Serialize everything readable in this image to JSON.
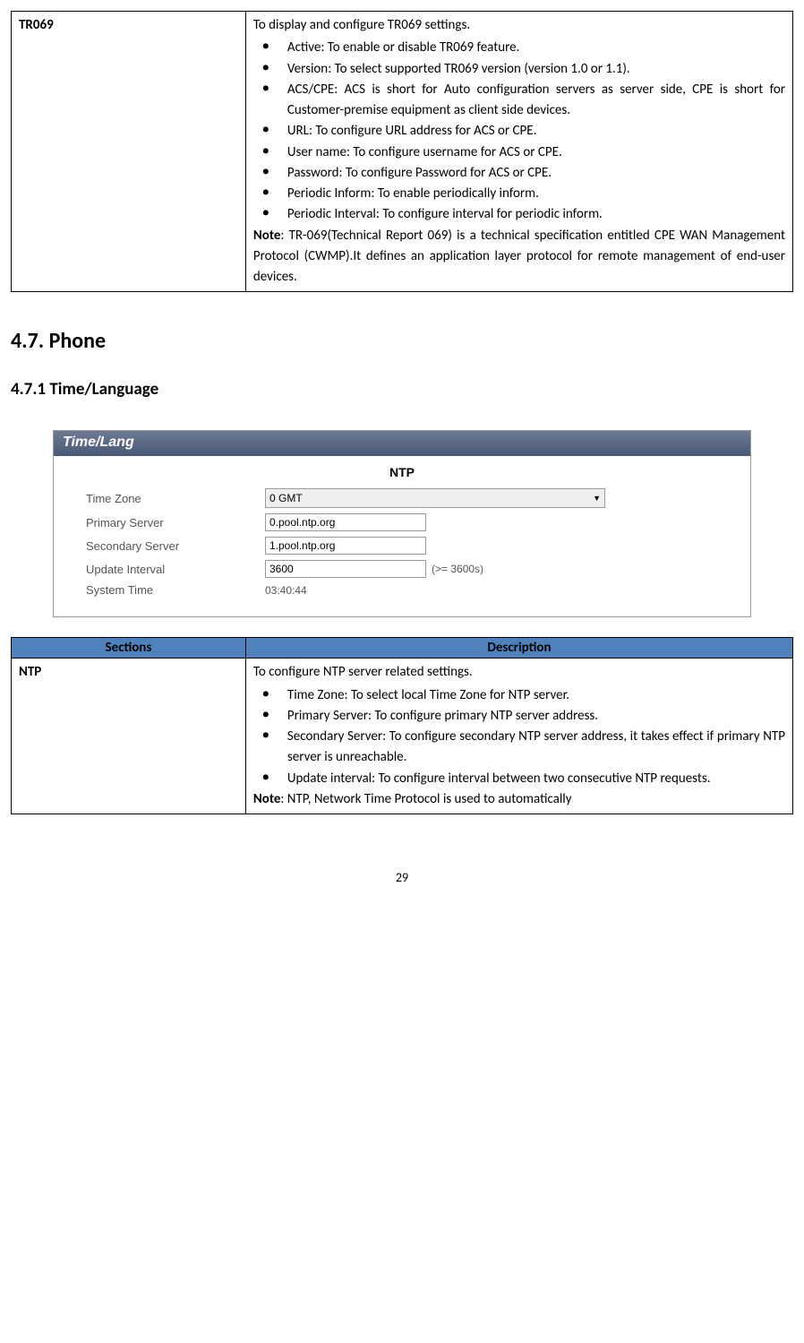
{
  "tr069": {
    "label": "TR069",
    "intro": "To display and configure TR069 settings.",
    "bullets": [
      "Active: To enable or disable TR069 feature.",
      "Version: To select supported TR069 version (version 1.0 or 1.1).",
      "ACS/CPE: ACS is short for Auto configuration servers as server side, CPE is short for Customer-premise equipment as client side devices.",
      "URL:   To configure URL address for ACS or CPE.",
      "User name: To configure username for ACS or CPE.",
      "Password: To configure Password for ACS or CPE.",
      "Periodic Inform: To enable periodically inform.",
      "Periodic Interval: To configure interval for periodic inform."
    ],
    "note_label": "Note",
    "note_body": ": TR-069(Technical Report 069) is a technical specification entitled CPE WAN Management Protocol (CWMP).It defines an application layer protocol for remote management of end-user devices."
  },
  "section47": "4.7. Phone",
  "section471": "4.7.1 Time/Language",
  "screenshot": {
    "panel_title": "Time/Lang",
    "group_title": "NTP",
    "timezone_label": "Time Zone",
    "timezone_value": "0 GMT",
    "primary_label": "Primary Server",
    "primary_value": "0.pool.ntp.org",
    "secondary_label": "Secondary Server",
    "secondary_value": "1.pool.ntp.org",
    "interval_label": "Update Interval",
    "interval_value": "3600",
    "interval_hint": "(>= 3600s)",
    "systime_label": "System Time",
    "systime_value": "03:40:44"
  },
  "table2": {
    "header_sections": "Sections",
    "header_description": "Description"
  },
  "ntp": {
    "label": "NTP",
    "intro": "To configure NTP server related settings.",
    "bullets": [
      "Time Zone: To select local Time Zone for NTP server.",
      "Primary Server: To configure primary NTP server address.",
      "Secondary Server: To configure secondary NTP server address, it takes effect if primary NTP server is unreachable.",
      "Update interval: To configure interval between two consecutive NTP requests."
    ],
    "note_label": "Note",
    "note_body": ": NTP, Network Time Protocol is used to automatically"
  },
  "page_number": "29"
}
